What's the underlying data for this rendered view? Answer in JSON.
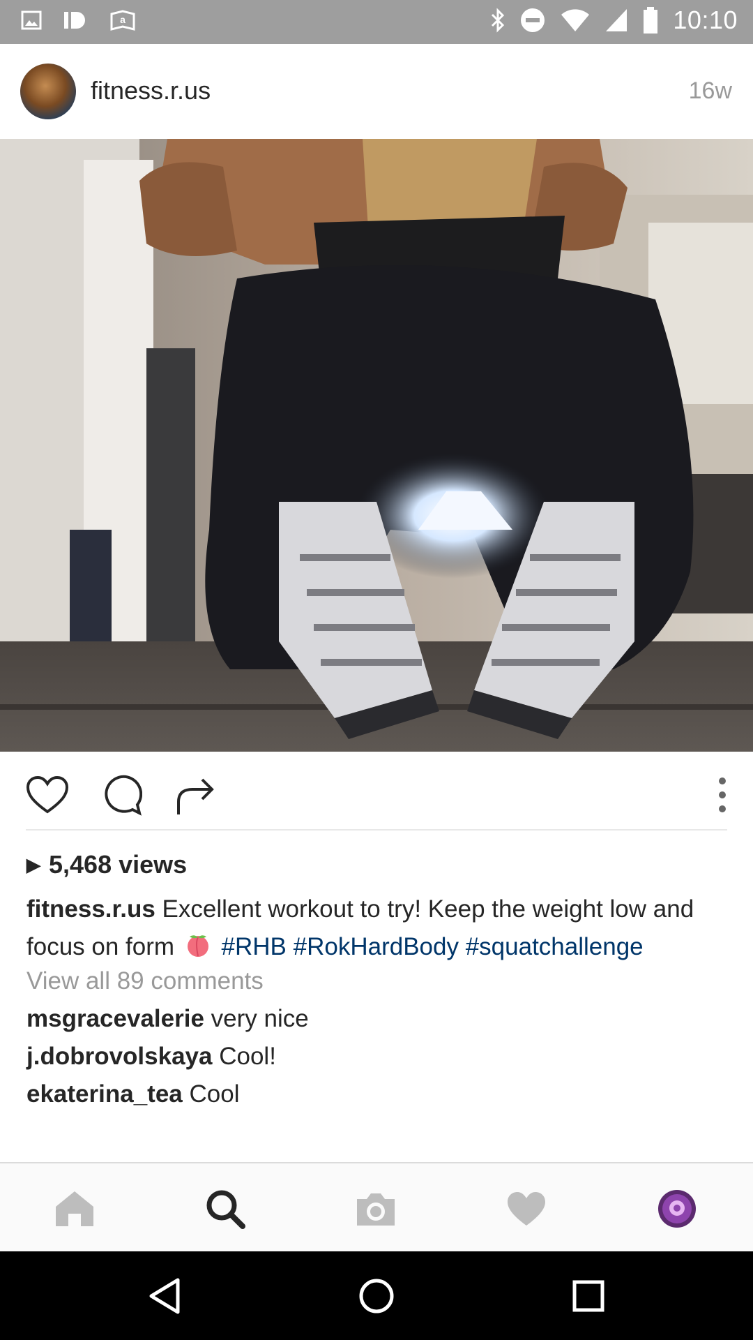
{
  "status_bar": {
    "time": "10:10",
    "left_icons": [
      "image-icon",
      "id-icon",
      "amazon-icon"
    ],
    "right_icons": [
      "bluetooth-icon",
      "do-not-disturb-icon",
      "wifi-icon",
      "signal-icon",
      "battery-icon"
    ]
  },
  "post": {
    "username": "fitness.r.us",
    "time_ago": "16w",
    "views": "5,468 views",
    "caption": {
      "username": "fitness.r.us",
      "text": "Excellent workout to try! Keep the weight low and focus on form",
      "emoji": "peach-emoji",
      "hashtags": [
        "#RHB",
        "#RokHardBody",
        "#squatchallenge"
      ]
    },
    "view_all_comments": "View all 89 comments",
    "comments": [
      {
        "username": "msgracevalerie",
        "text": "very nice"
      },
      {
        "username": "j.dobrovolskaya",
        "text": "Cool!"
      },
      {
        "username": "ekaterina_tea",
        "text": "Cool"
      }
    ]
  },
  "actions": [
    "heart-icon",
    "comment-icon",
    "share-icon",
    "more-options-icon"
  ],
  "bottom_nav": {
    "items": [
      "home-icon",
      "search-icon",
      "camera-icon",
      "activity-heart-icon",
      "profile-avatar"
    ],
    "active": "search-icon"
  },
  "android_nav": [
    "back-icon",
    "home-circle-icon",
    "recents-icon"
  ],
  "colors": {
    "status_bar": "#9e9e9e",
    "hashtag": "#003569",
    "muted_text": "#999999",
    "profile_accent": "#8e44ad"
  }
}
